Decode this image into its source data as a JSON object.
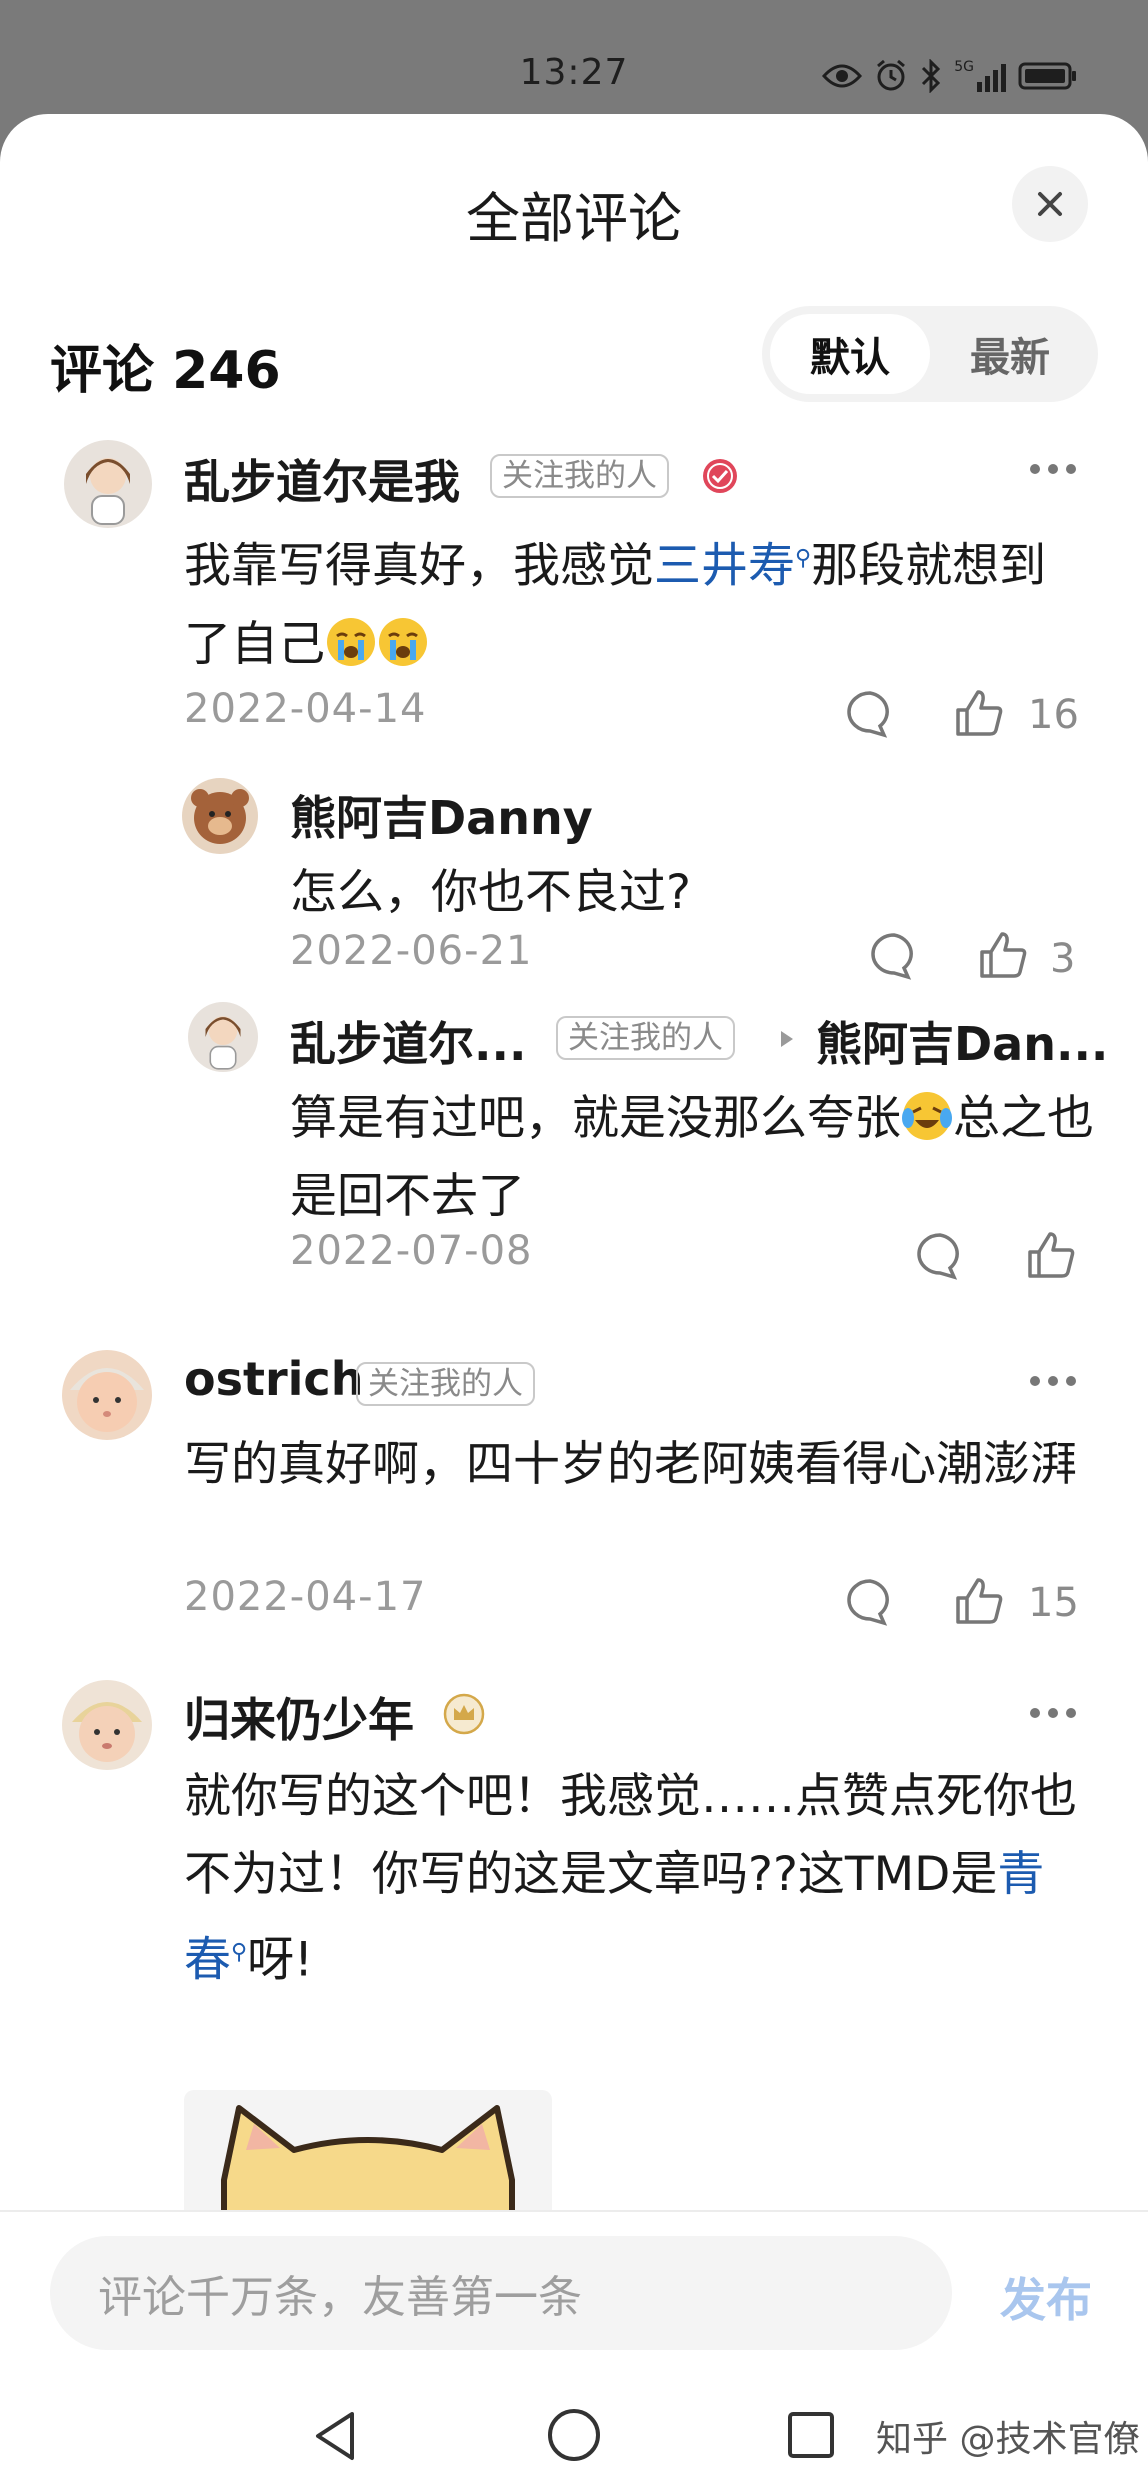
{
  "status_bar": {
    "time": "13:27",
    "icons": [
      "eye-icon",
      "alarm-icon",
      "bluetooth-icon",
      "signal-5g-icon",
      "battery-icon"
    ],
    "signal_label": "5G"
  },
  "sheet": {
    "title": "全部评论",
    "close_icon": "close-icon"
  },
  "comments_header": {
    "label": "评论 246",
    "sort_options": [
      "默认",
      "最新"
    ],
    "active_sort": "默认"
  },
  "comments": [
    {
      "author": "乱步道尔是我",
      "tag": "关注我的人",
      "verified_badge": "check-badge-icon",
      "text_before": "我靠写得真好，我感觉",
      "link": "三井寿",
      "text_after": "那段就想到了自己",
      "emoji": [
        "crying-emoji",
        "crying-emoji"
      ],
      "date": "2022-04-14",
      "likes": "16",
      "replies": [
        {
          "author": "熊阿吉Danny",
          "text": "怎么，你也不良过?",
          "date": "2022-06-21",
          "likes": "3"
        },
        {
          "author": "乱步道尔...",
          "tag": "关注我的人",
          "reply_to": "熊阿吉Dan...",
          "text_before": "算是有过吧，就是没那么夸张",
          "text_after": "总之也是回不去了",
          "emoji": [
            "laugh-cry-emoji"
          ],
          "date": "2022-07-08",
          "likes": ""
        }
      ]
    },
    {
      "author": "ostrich",
      "tag": "关注我的人",
      "text": "写的真好啊，四十岁的老阿姨看得心潮澎湃",
      "date": "2022-04-17",
      "likes": "15"
    },
    {
      "author": "归来仍少年",
      "badge": "crown-badge-icon",
      "text_before": "就你写的这个吧！我感觉……点赞点死你也不为过！你写的这是文章吗??这TMD是",
      "link": "青春",
      "text_after": "呀!",
      "image": "cat-sticker"
    }
  ],
  "composer": {
    "placeholder": "评论千万条，友善第一条",
    "publish_label": "发布"
  },
  "nav_bar": {
    "buttons": [
      "back-icon",
      "home-icon",
      "recents-icon"
    ],
    "watermark": "知乎 @技术官僚"
  },
  "colors": {
    "link": "#1c5bb0",
    "publish_disabled": "#a9c6ee",
    "verified_red": "#e0465a",
    "crown_gold": "#d4a84a"
  }
}
